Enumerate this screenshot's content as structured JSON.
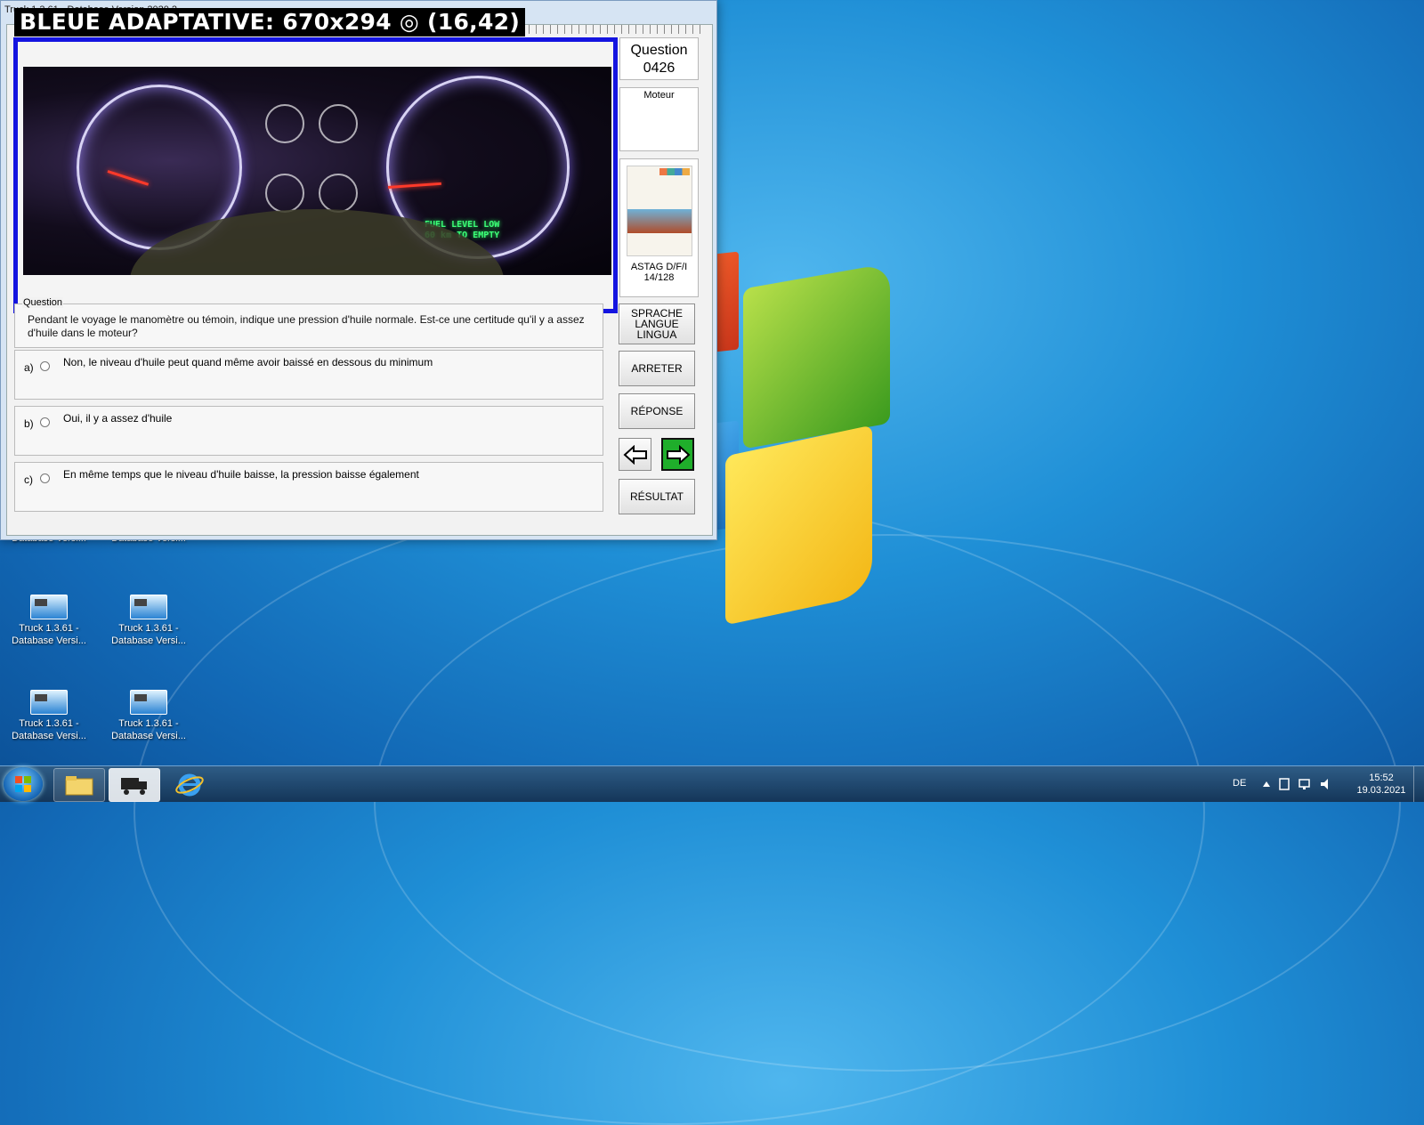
{
  "app": {
    "title": "Truck 1.3.61 - Database Version 2020.2",
    "overlay_label": "BLEUE ADAPTATIVE: 670x294 ◎ (16,42)"
  },
  "image": {
    "fuel_text_line1": "FUEL LEVEL LOW",
    "fuel_text_line2": "60 km TO EMPTY"
  },
  "sidebar": {
    "question_label": "Question",
    "question_number": "0426",
    "category": "Moteur",
    "book_name": "ASTAG D/F/I",
    "book_page": "14/128"
  },
  "question": {
    "legend": "Question",
    "text": "Pendant le voyage le manomètre ou témoin, indique une pression d'huile normale. Est-ce une certitude qu'il y a assez d'huile dans le moteur?"
  },
  "answers": [
    {
      "letter": "a)",
      "text": "Non, le niveau d'huile peut quand même avoir baissé en dessous du minimum"
    },
    {
      "letter": "b)",
      "text": "Oui, il y a assez d'huile"
    },
    {
      "letter": "c)",
      "text": "En même temps que le niveau d'huile baisse, la pression baisse également"
    }
  ],
  "buttons": {
    "language_line1": "SPRACHE",
    "language_line2": "LANGUE",
    "language_line3": "LINGUA",
    "stop": "ARRETER",
    "answer": "RÉPONSE",
    "result": "RÉSULTAT"
  },
  "desktop_icons": [
    {
      "line1": "",
      "line2": "Database Versi..."
    },
    {
      "line1": "",
      "line2": "Database Versi..."
    },
    {
      "line1": "Truck 1.3.61 -",
      "line2": "Database Versi..."
    },
    {
      "line1": "Truck 1.3.61 -",
      "line2": "Database Versi..."
    },
    {
      "line1": "Truck 1.3.61 -",
      "line2": "Database Versi..."
    },
    {
      "line1": "Truck 1.3.61 -",
      "line2": "Database Versi..."
    }
  ],
  "taskbar": {
    "language": "DE",
    "time": "15:52",
    "date": "19.03.2021"
  },
  "colors": {
    "frame_blue": "#1414e0",
    "next_green": "#1fae2b"
  }
}
